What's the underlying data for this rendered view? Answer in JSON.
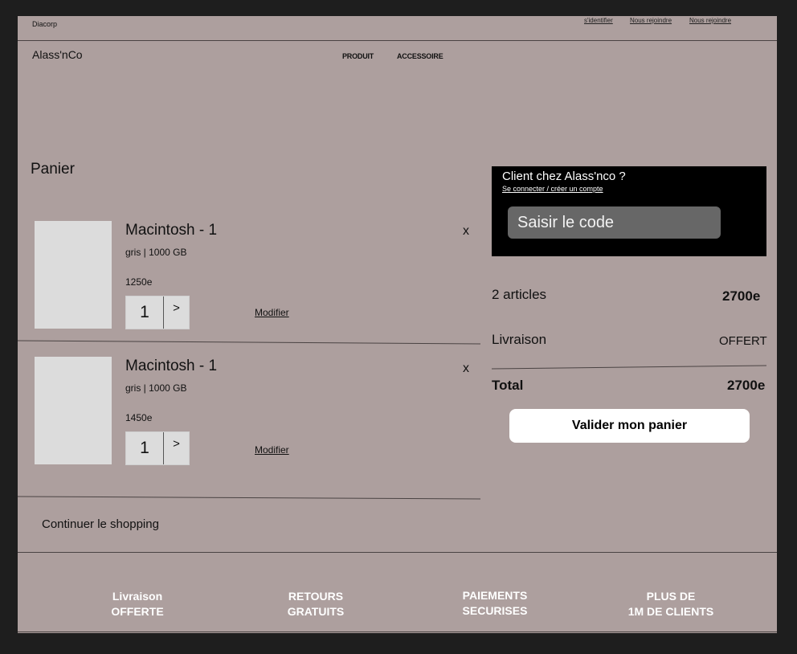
{
  "topbar": {
    "brand": "Diacorp",
    "links": [
      "s'identifier",
      "Nous rejoindre",
      "Nous rejoindre"
    ]
  },
  "header": {
    "logo": "Alass'nCo",
    "nav": [
      "PRODUIT",
      "ACCESSOIRE"
    ]
  },
  "cart": {
    "title": "Panier",
    "items": [
      {
        "name": "Macintosh - 1",
        "specs": "gris | 1000 GB",
        "price": "1250e",
        "quantity": "1",
        "increment": ">",
        "modify": "Modifier",
        "remove": "x"
      },
      {
        "name": "Macintosh - 1",
        "specs": "gris | 1000 GB",
        "price": "1450e",
        "quantity": "1",
        "increment": ">",
        "modify": "Modifier",
        "remove": "x"
      }
    ],
    "continue": "Continuer le shopping"
  },
  "client": {
    "title": "Client chez Alass'nco ?",
    "link": "Se connecter / créer un compte",
    "code_placeholder": "Saisir le code"
  },
  "summary": {
    "articles_label": "2 articles",
    "articles_value": "2700e",
    "delivery_label": "Livraison",
    "delivery_value": "OFFERT",
    "total_label": "Total",
    "total_value": "2700e",
    "validate": "Valider mon panier"
  },
  "footer": {
    "items": [
      [
        "Livraison",
        "OFFERTE"
      ],
      [
        "RETOURS",
        "GRATUITS"
      ],
      [
        "PAIEMENTS",
        "SECURISES"
      ],
      [
        "PLUS DE",
        "1M DE CLIENTS"
      ]
    ]
  },
  "colors": {
    "page_background": "#ad9f9e",
    "outer_background": "#1e1e1e",
    "client_box": "#000000",
    "code_input": "#676767",
    "button": "#ffffff",
    "thumbnail": "#dcdcdc"
  }
}
